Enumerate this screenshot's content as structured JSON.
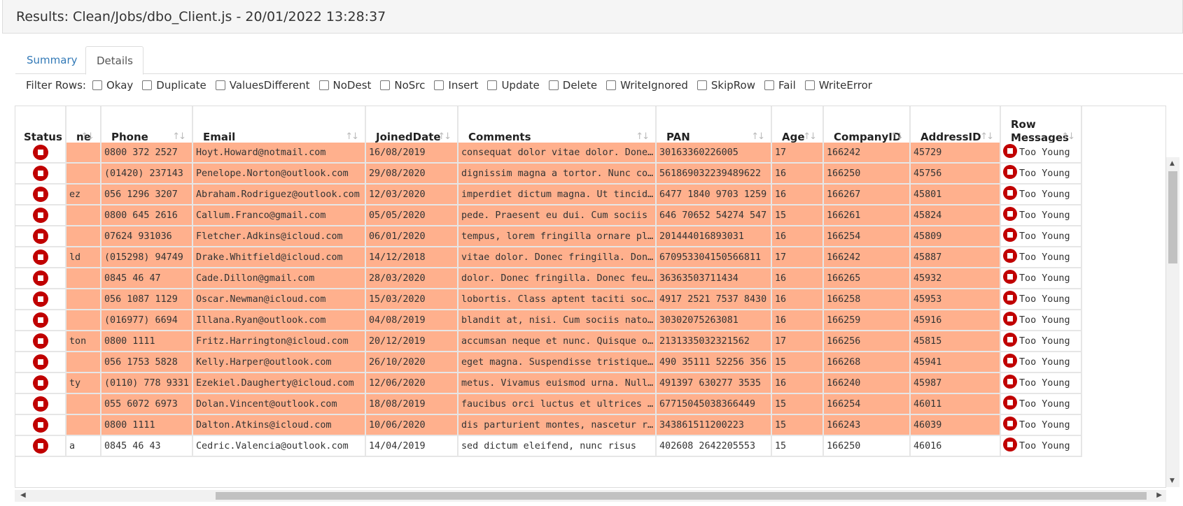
{
  "panel": {
    "title": "Results: Clean/Jobs/dbo_Client.js - 20/01/2022 13:28:37"
  },
  "tabs": [
    {
      "label": "Summary",
      "active": false
    },
    {
      "label": "Details",
      "active": true
    }
  ],
  "filters": {
    "label": "Filter Rows:",
    "options": [
      "Okay",
      "Duplicate",
      "ValuesDifferent",
      "NoDest",
      "NoSrc",
      "Insert",
      "Update",
      "Delete",
      "WriteIgnored",
      "SkipRow",
      "Fail",
      "WriteError"
    ]
  },
  "grid": {
    "columns": {
      "status": "Status",
      "name": "ne",
      "phone": "Phone",
      "email": "Email",
      "joined": "JoinedDate",
      "comments": "Comments",
      "pan": "PAN",
      "age": "Age",
      "company": "CompanyID",
      "address": "AddressID",
      "messages_line1": "Row",
      "messages_line2": "Messages"
    },
    "sort_icon": "↑↓",
    "rows": [
      {
        "name": "",
        "phone": "0800 372 2527",
        "email": "Hoyt.Howard@notmail.com",
        "joined": "16/08/2019",
        "comments": "consequat dolor vitae dolor. Donec fringilla",
        "pan": "30163360226005",
        "age": "17",
        "company": "166242",
        "address": "45729",
        "message": "Too Young",
        "state": "err"
      },
      {
        "name": "",
        "phone": "(01420) 237143",
        "email": "Penelope.Norton@outlook.com",
        "joined": "29/08/2020",
        "comments": "dignissim magna a tortor. Nunc commodo",
        "pan": "561869032239489622",
        "age": "16",
        "company": "166250",
        "address": "45756",
        "message": "Too Young",
        "state": "err"
      },
      {
        "name": "ez",
        "phone": "056 1296 3207",
        "email": "Abraham.Rodriguez@outlook.com",
        "joined": "12/03/2020",
        "comments": "imperdiet dictum magna. Ut tincidunt",
        "pan": "6477 1840 9703 1259",
        "age": "16",
        "company": "166267",
        "address": "45801",
        "message": "Too Young",
        "state": "err"
      },
      {
        "name": "",
        "phone": "0800 645 2616",
        "email": "Callum.Franco@gmail.com",
        "joined": "05/05/2020",
        "comments": "pede. Praesent eu dui. Cum sociis",
        "pan": "646 70652 54274 547",
        "age": "15",
        "company": "166261",
        "address": "45824",
        "message": "Too Young",
        "state": "err"
      },
      {
        "name": "",
        "phone": "07624 931036",
        "email": "Fletcher.Adkins@icloud.com",
        "joined": "06/01/2020",
        "comments": "tempus, lorem fringilla ornare placerat",
        "pan": "201444016893031",
        "age": "16",
        "company": "166254",
        "address": "45809",
        "message": "Too Young",
        "state": "err"
      },
      {
        "name": "ld",
        "phone": "(015298) 94749",
        "email": "Drake.Whitfield@icloud.com",
        "joined": "14/12/2018",
        "comments": "vitae dolor. Donec fringilla. Donec",
        "pan": "670953304150566811",
        "age": "17",
        "company": "166242",
        "address": "45887",
        "message": "Too Young",
        "state": "err"
      },
      {
        "name": "",
        "phone": "0845 46 47",
        "email": "Cade.Dillon@gmail.com",
        "joined": "28/03/2020",
        "comments": "dolor. Donec fringilla. Donec feugiat",
        "pan": "36363503711434",
        "age": "16",
        "company": "166265",
        "address": "45932",
        "message": "Too Young",
        "state": "err"
      },
      {
        "name": "",
        "phone": "056 1087 1129",
        "email": "Oscar.Newman@icloud.com",
        "joined": "15/03/2020",
        "comments": "lobortis. Class aptent taciti sociosqu",
        "pan": "4917 2521 7537 8430",
        "age": "16",
        "company": "166258",
        "address": "45953",
        "message": "Too Young",
        "state": "err"
      },
      {
        "name": "",
        "phone": "(016977) 6694",
        "email": "Illana.Ryan@outlook.com",
        "joined": "04/08/2019",
        "comments": "blandit at, nisi. Cum sociis natoque",
        "pan": "30302075263081",
        "age": "16",
        "company": "166259",
        "address": "45916",
        "message": "Too Young",
        "state": "err"
      },
      {
        "name": "ton",
        "phone": "0800 1111",
        "email": "Fritz.Harrington@icloud.com",
        "joined": "20/12/2019",
        "comments": "accumsan neque et nunc. Quisque ornare",
        "pan": "2131335032321562",
        "age": "17",
        "company": "166256",
        "address": "45815",
        "message": "Too Young",
        "state": "err"
      },
      {
        "name": "",
        "phone": "056 1753 5828",
        "email": "Kelly.Harper@outlook.com",
        "joined": "26/10/2020",
        "comments": "eget magna. Suspendisse tristique neque",
        "pan": "490 35111 52256 356",
        "age": "15",
        "company": "166268",
        "address": "45941",
        "message": "Too Young",
        "state": "err"
      },
      {
        "name": "ty",
        "phone": "(0110) 778 9331",
        "email": "Ezekiel.Daugherty@icloud.com",
        "joined": "12/06/2020",
        "comments": "metus. Vivamus euismod urna. Nullam",
        "pan": "491397 630277 3535",
        "age": "16",
        "company": "166240",
        "address": "45987",
        "message": "Too Young",
        "state": "err"
      },
      {
        "name": "",
        "phone": "055 6072 6973",
        "email": "Dolan.Vincent@outlook.com",
        "joined": "18/08/2019",
        "comments": "faucibus orci luctus et ultrices posuere",
        "pan": "67715045038366449",
        "age": "15",
        "company": "166254",
        "address": "46011",
        "message": "Too Young",
        "state": "err"
      },
      {
        "name": "",
        "phone": "0800 1111",
        "email": "Dalton.Atkins@icloud.com",
        "joined": "10/06/2020",
        "comments": "dis parturient montes, nascetur ridiculus",
        "pan": "343861511200223",
        "age": "15",
        "company": "166243",
        "address": "46039",
        "message": "Too Young",
        "state": "err"
      },
      {
        "name": "a",
        "phone": "0845 46 43",
        "email": "Cedric.Valencia@outlook.com",
        "joined": "14/04/2019",
        "comments": "sed dictum eleifend, nunc risus",
        "pan": "402608 2642205553",
        "age": "15",
        "company": "166250",
        "address": "46016",
        "message": "Too Young",
        "state": "ok"
      }
    ]
  },
  "colors": {
    "error_row": "#ffb08d",
    "stop_icon": "#c00000",
    "link": "#337ab7"
  }
}
